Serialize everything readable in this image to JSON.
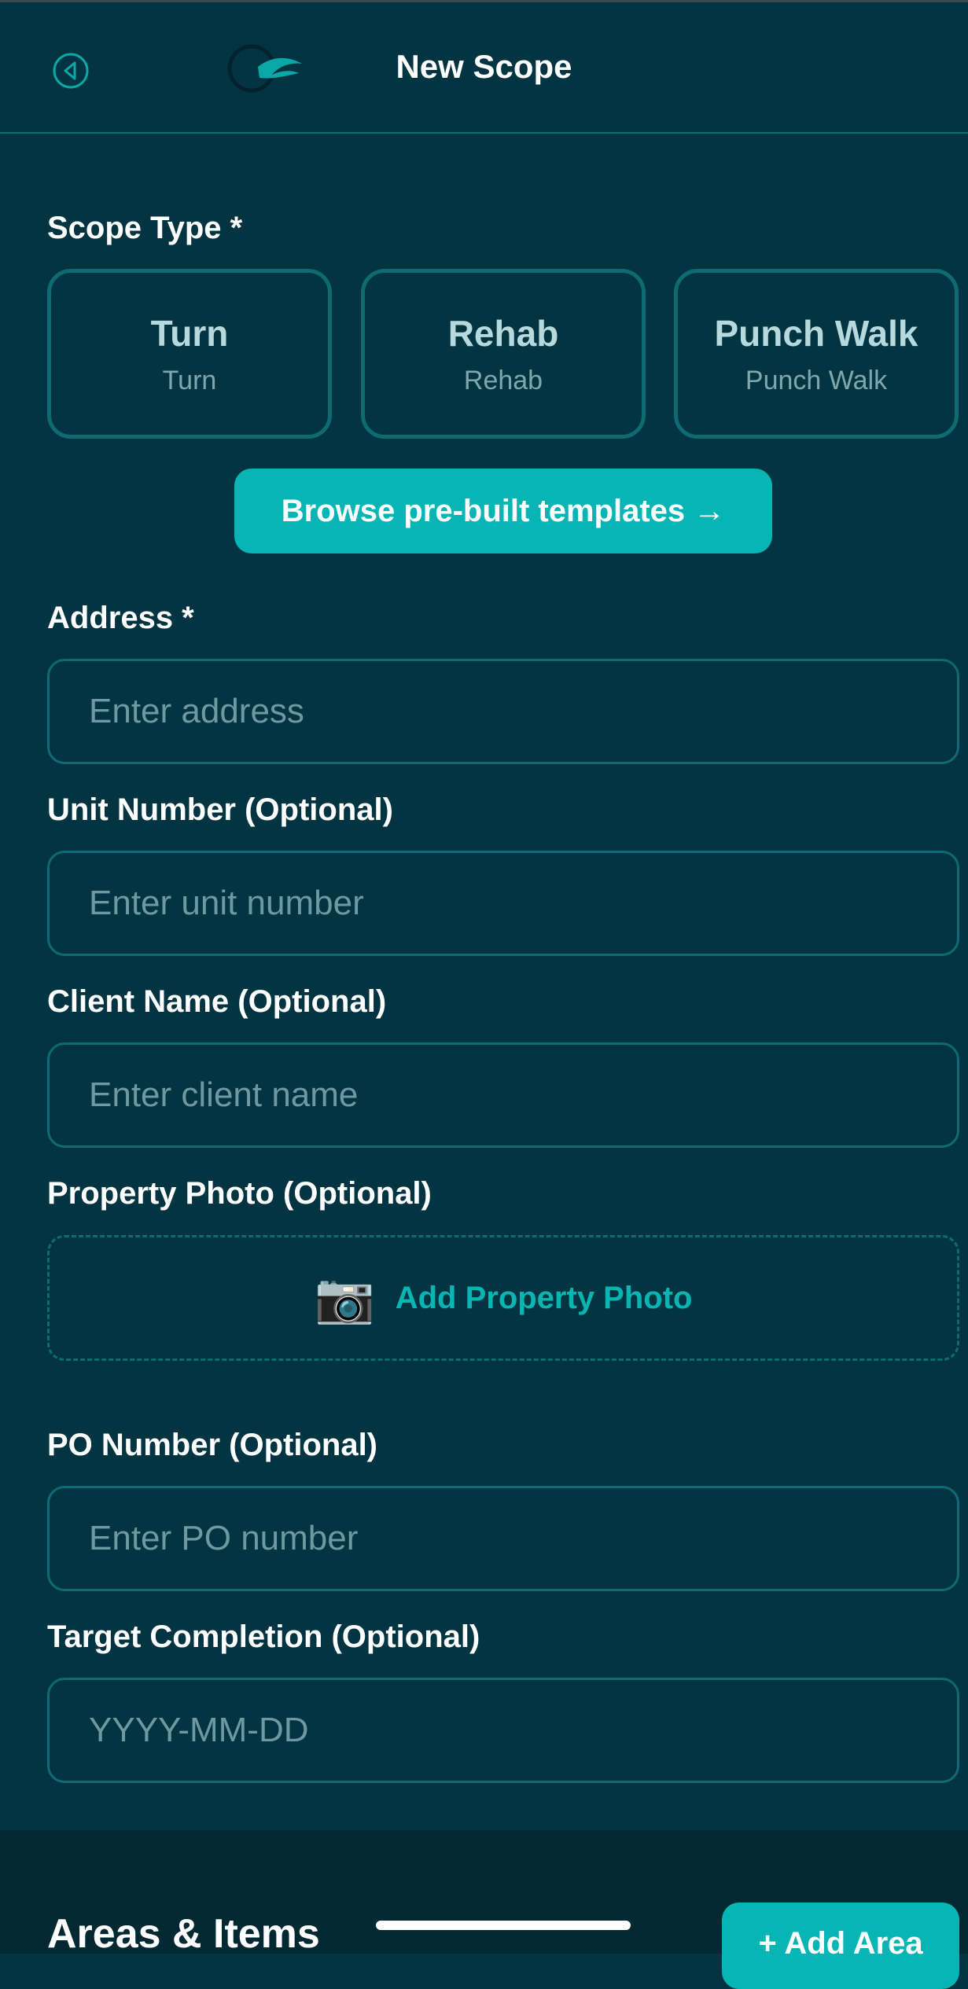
{
  "header": {
    "title": "New Scope",
    "back_icon": "back-circle-icon",
    "logo": "app-logo"
  },
  "scope_type": {
    "label": "Scope Type *",
    "options": [
      {
        "title": "Turn",
        "subtitle": "Turn"
      },
      {
        "title": "Rehab",
        "subtitle": "Rehab"
      },
      {
        "title": "Punch Walk",
        "subtitle": "Punch Walk"
      }
    ],
    "browse_label": "Browse pre-built templates →"
  },
  "address": {
    "label": "Address *",
    "placeholder": "Enter address"
  },
  "unit_number": {
    "label": "Unit Number (Optional)",
    "placeholder": "Enter unit number"
  },
  "client_name": {
    "label": "Client Name (Optional)",
    "placeholder": "Enter client name"
  },
  "property_photo": {
    "label": "Property Photo (Optional)",
    "button_label": "Add Property Photo",
    "icon": "📷"
  },
  "po_number": {
    "label": "PO Number (Optional)",
    "placeholder": "Enter PO number"
  },
  "target_completion": {
    "label": "Target Completion (Optional)",
    "placeholder": "YYYY-MM-DD"
  },
  "areas": {
    "title": "Areas & Items",
    "add_label": "+ Add Area"
  },
  "colors": {
    "background": "#033441",
    "accent": "#07b6b4",
    "border": "#0e6b73",
    "bottom_panel": "#022832"
  }
}
